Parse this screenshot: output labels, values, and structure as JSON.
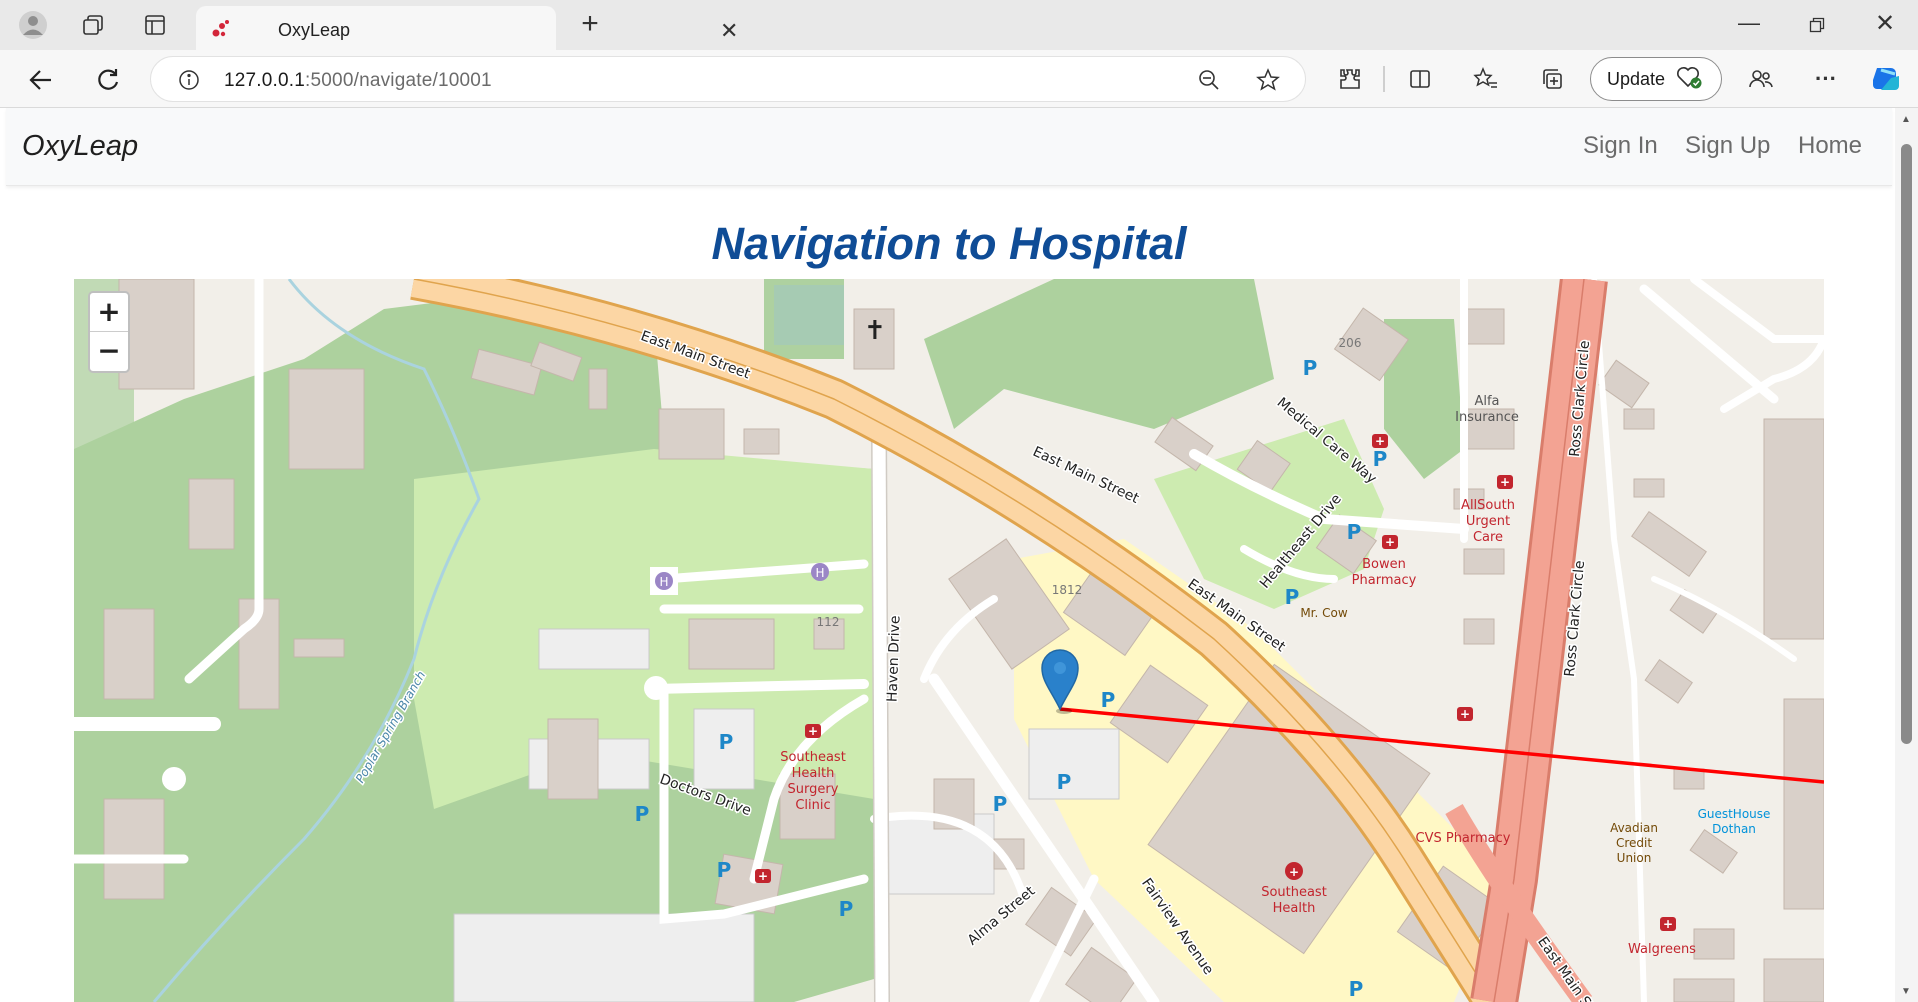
{
  "browser": {
    "tab_title": "OxyLeap",
    "url_host": "127.0.0.1",
    "url_path": ":5000/navigate/10001",
    "update_label": "Update"
  },
  "page": {
    "brand": "OxyLeap",
    "nav": {
      "sign_in": "Sign In",
      "sign_up": "Sign Up",
      "home": "Home"
    },
    "heading": "Navigation to Hospital"
  },
  "map": {
    "zoom_in": "+",
    "zoom_out": "−",
    "route_color": "#ff0000",
    "marker_color": "#2a81cb",
    "streets": {
      "east_main_1": "East Main Street",
      "east_main_2": "East Main Street",
      "east_main_3": "East Main Street",
      "east_main_4": "East Main Str",
      "haven": "Haven Drive",
      "doctors": "Doctors Drive",
      "alma": "Alma Street",
      "fairview": "Fairview Avenue",
      "medical_care": "Medical Care Way",
      "healtheast": "Healtheast Drive",
      "ross_1": "Ross Clark Circle",
      "ross_2": "Ross Clark Circle",
      "poplar": "Poplar Spring Branch"
    },
    "pois": {
      "surgery_1": "Southeast",
      "surgery_2": "Health",
      "surgery_3": "Surgery",
      "surgery_4": "Clinic",
      "southeast_1": "Southeast",
      "southeast_2": "Health",
      "allsouth_1": "AllSouth",
      "allsouth_2": "Urgent",
      "allsouth_3": "Care",
      "bowen_1": "Bowen",
      "bowen_2": "Pharmacy",
      "cvs": "CVS Pharmacy",
      "walgreens": "Walgreens",
      "alfa_1": "Alfa",
      "alfa_2": "Insurance",
      "mrcow": "Mr. Cow",
      "avadian_1": "Avadian",
      "avadian_2": "Credit",
      "avadian_3": "Union",
      "guesthouse_1": "GuestHouse",
      "guesthouse_2": "Dothan"
    },
    "numbers": {
      "n206": "206",
      "n1812": "1812",
      "n112": "112"
    },
    "parking": "P",
    "helipad": "H"
  }
}
